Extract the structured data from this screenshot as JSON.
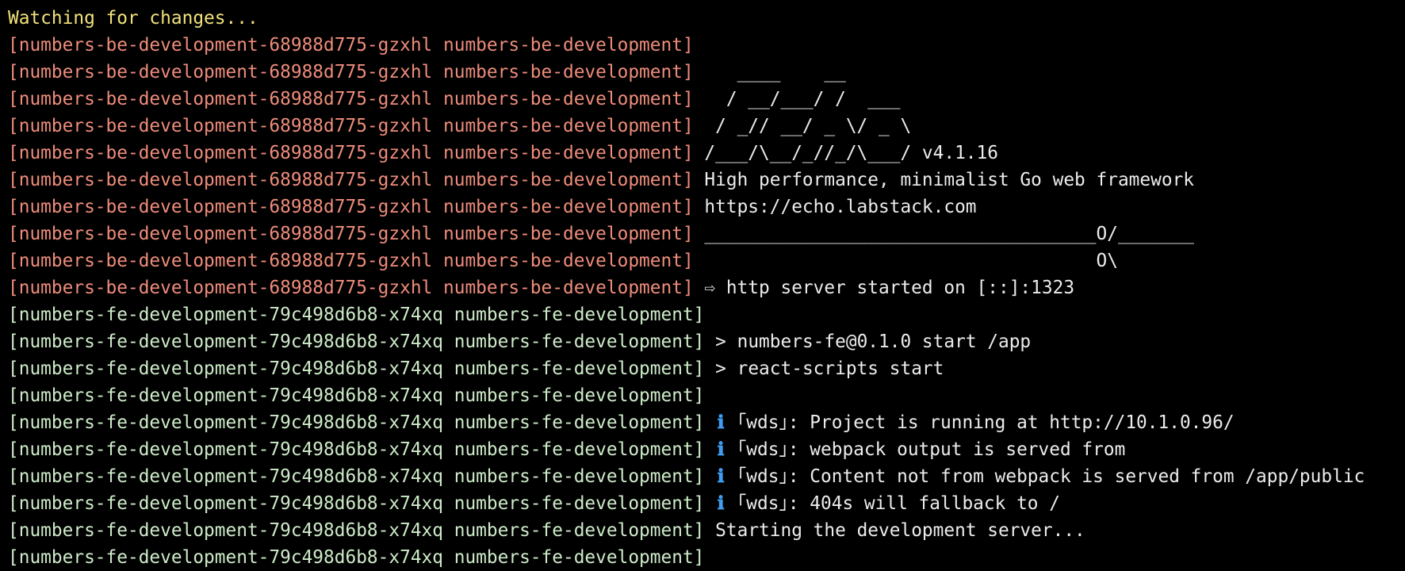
{
  "header": "Watching for changes...",
  "be_prefix": "[numbers-be-development-68988d775-gzxhl numbers-be-development]",
  "fe_prefix": "[numbers-fe-development-79c498d6b8-x74xq numbers-fe-development]",
  "colors": {
    "watch": "#f2e27a",
    "be_prefix": "#ee8c7b",
    "fe_prefix": "#cdebc8",
    "text": "#ececec",
    "info_icon": "#3f9cf0",
    "background": "#000000"
  },
  "be_lines": [
    "",
    "   ____    __",
    "  / __/___/ /  ___",
    " / _// __/ _ \\/ _ \\",
    "/___/\\__/_//_/\\___/ v4.1.16",
    "High performance, minimalist Go web framework",
    "https://echo.labstack.com",
    "____________________________________O/_______",
    "                                    O\\",
    "⇨ http server started on [::]:1323"
  ],
  "fe_lines": [
    "",
    "> numbers-fe@0.1.0 start /app",
    "> react-scripts start",
    "",
    "Project is running at http://10.1.0.96/",
    "webpack output is served from",
    "Content not from webpack is served from /app/public",
    "404s will fallback to /",
    "Starting the development server...",
    ""
  ],
  "info_icon": "ℹ",
  "wds_label": "｢wds｣: "
}
